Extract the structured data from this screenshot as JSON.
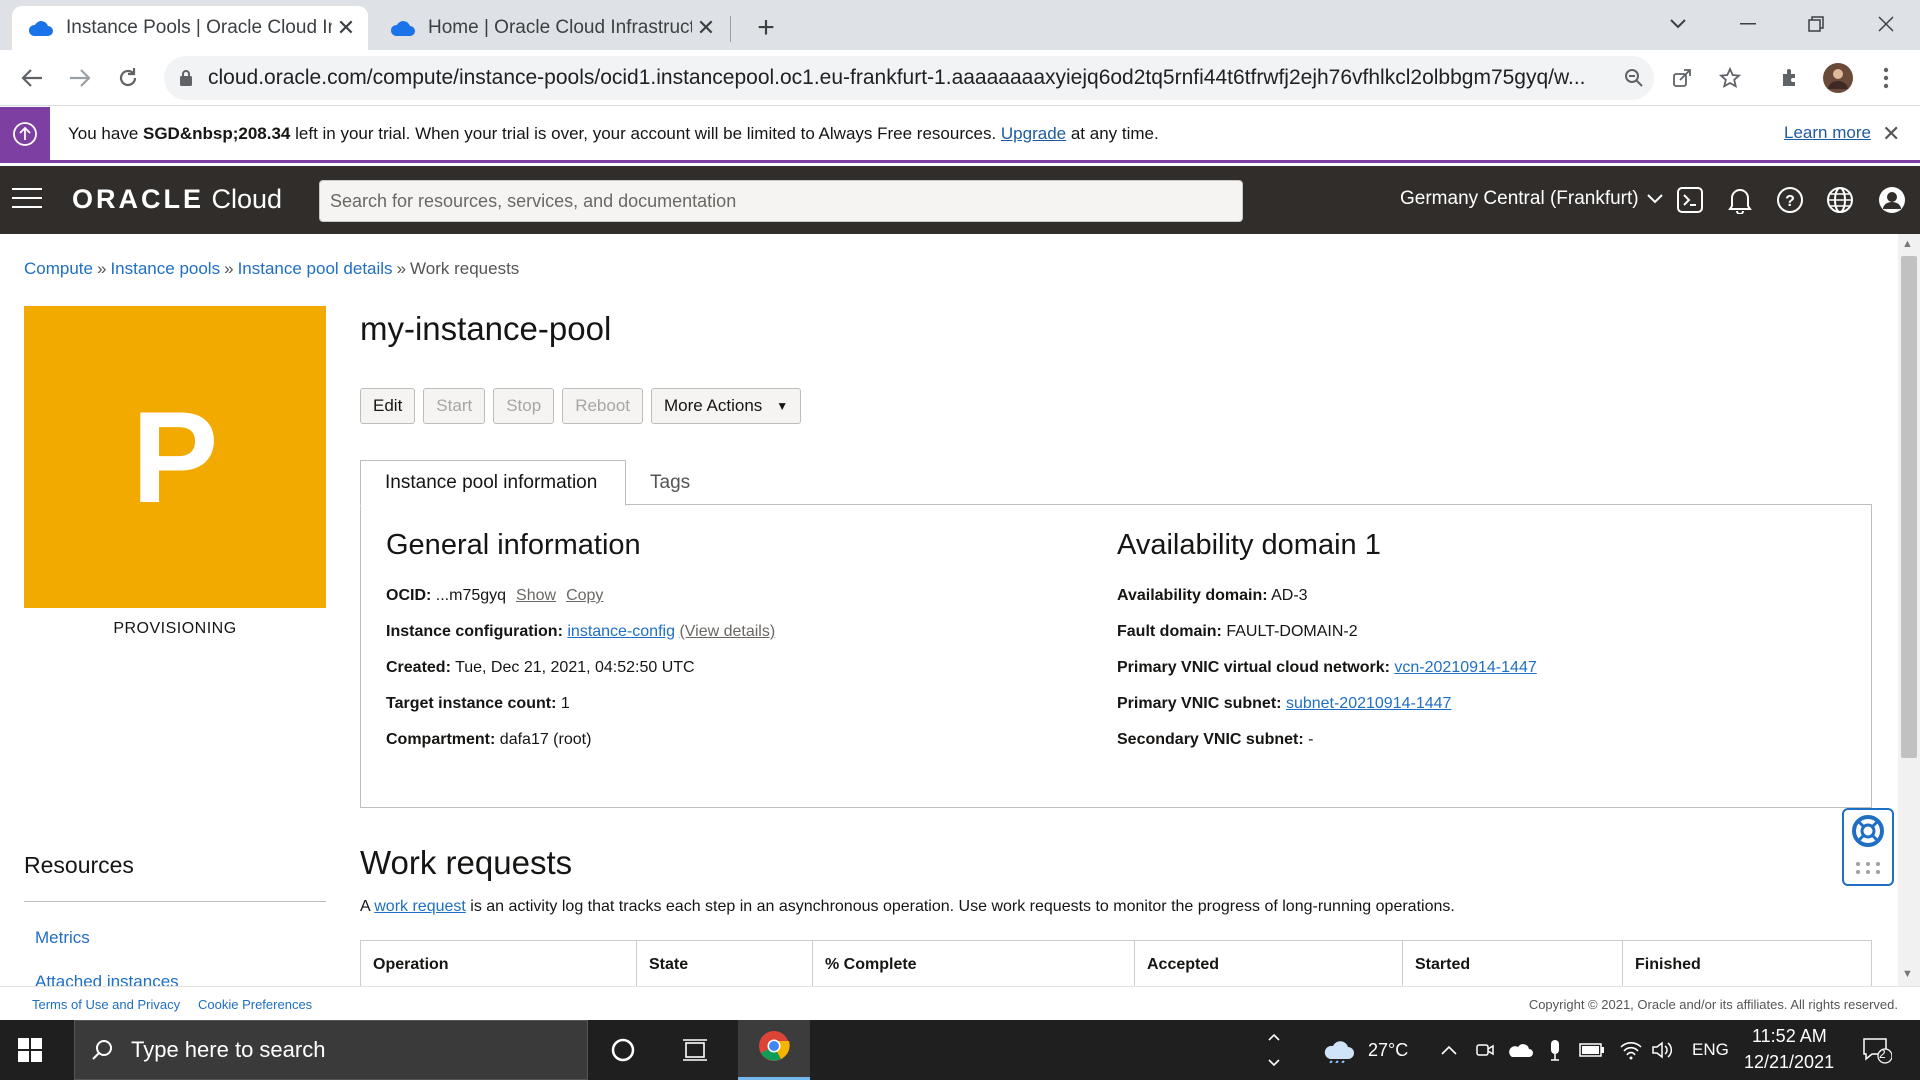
{
  "browser": {
    "tabs": [
      {
        "title": "Instance Pools | Oracle Cloud Infr",
        "active": true
      },
      {
        "title": "Home | Oracle Cloud Infrastructu",
        "active": false
      }
    ],
    "url": "cloud.oracle.com/compute/instance-pools/ocid1.instancepool.oc1.eu-frankfurt-1.aaaaaaaaxyiejq6od2tq5rnfi44t6tfrwfj2ejh76vfhlkcl2olbbgm75gyq/w..."
  },
  "trial_banner": {
    "prefix": "You have ",
    "amount": "SGD&nbsp;208.34",
    "middle": " left in your trial. When your trial is over, your account will be limited to Always Free resources. ",
    "upgrade": "Upgrade",
    "suffix": " at any time.",
    "learn_more": "Learn more"
  },
  "header": {
    "logo_oracle": "ORACLE",
    "logo_cloud": " Cloud",
    "search_placeholder": "Search for resources, services, and documentation",
    "region": "Germany Central (Frankfurt)"
  },
  "breadcrumb": {
    "items": [
      "Compute",
      "Instance pools",
      "Instance pool details"
    ],
    "current": "Work requests",
    "sep": "»"
  },
  "resource": {
    "letter": "P",
    "status": "PROVISIONING",
    "status_color": "#f2a900",
    "title": "my-instance-pool"
  },
  "actions": {
    "edit": "Edit",
    "start": "Start",
    "stop": "Stop",
    "reboot": "Reboot",
    "more": "More Actions"
  },
  "info_tabs": [
    "Instance pool information",
    "Tags"
  ],
  "general": {
    "heading": "General information",
    "ocid_label": "OCID:",
    "ocid_value": "...m75gyq",
    "show": "Show",
    "copy": "Copy",
    "config_label": "Instance configuration:",
    "config_value": "instance-config",
    "config_details": "(View details)",
    "created_label": "Created:",
    "created_value": "Tue, Dec 21, 2021, 04:52:50 UTC",
    "target_label": "Target instance count:",
    "target_value": "1",
    "compartment_label": "Compartment:",
    "compartment_value": "dafa17 (root)"
  },
  "availability": {
    "heading": "Availability domain 1",
    "ad_label": "Availability domain:",
    "ad_value": "AD-3",
    "fd_label": "Fault domain:",
    "fd_value": "FAULT-DOMAIN-2",
    "vcn_label": "Primary VNIC virtual cloud network:",
    "vcn_value": "vcn-20210914-1447",
    "subnet_label": "Primary VNIC subnet:",
    "subnet_value": "subnet-20210914-1447",
    "secondary_label": "Secondary VNIC subnet:",
    "secondary_value": "-"
  },
  "resources": {
    "heading": "Resources",
    "links": [
      "Metrics",
      "Attached instances"
    ]
  },
  "work_requests": {
    "heading": "Work requests",
    "desc_prefix": "A ",
    "desc_link": "work request",
    "desc_suffix": " is an activity log that tracks each step in an asynchronous operation. Use work requests to monitor the progress of long-running operations.",
    "columns": [
      "Operation",
      "State",
      "% Complete",
      "Accepted",
      "Started",
      "Finished"
    ]
  },
  "footer": {
    "terms": "Terms of Use and Privacy",
    "cookies": "Cookie Preferences",
    "copyright": "Copyright © 2021, Oracle and/or its affiliates. All rights reserved."
  },
  "taskbar": {
    "search_placeholder": "Type here to search",
    "temperature": "27°C",
    "language": "ENG",
    "time": "11:52 AM",
    "date": "12/21/2021",
    "notifications": "2"
  }
}
